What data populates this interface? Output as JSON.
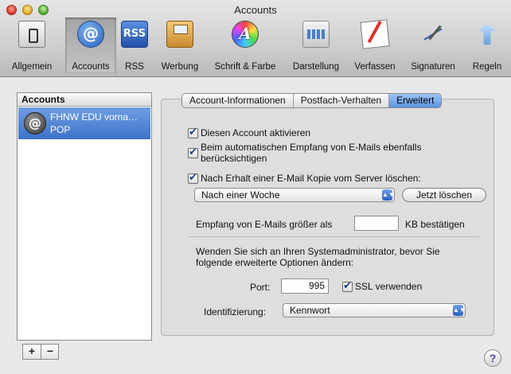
{
  "window": {
    "title": "Accounts"
  },
  "toolbar": {
    "items": [
      {
        "label": "Allgemein",
        "icon": "switch-icon"
      },
      {
        "label": "Accounts",
        "icon": "at-sign-icon",
        "selected": true
      },
      {
        "label": "RSS",
        "icon": "rss-icon",
        "icon_text": "RSS"
      },
      {
        "label": "Werbung",
        "icon": "junk-mail-icon"
      },
      {
        "label": "Schrift & Farbe",
        "icon": "font-color-icon",
        "icon_text": "A"
      },
      {
        "label": "Darstellung",
        "icon": "viewing-icon"
      },
      {
        "label": "Verfassen",
        "icon": "compose-icon"
      },
      {
        "label": "Signaturen",
        "icon": "signature-icon"
      },
      {
        "label": "Regeln",
        "icon": "rules-icon"
      }
    ]
  },
  "accounts": {
    "header": "Accounts",
    "items": [
      {
        "name": "FHNW EDU vorna…",
        "type": "POP",
        "selected": true
      }
    ],
    "add_label": "+",
    "remove_label": "−"
  },
  "tabs": [
    {
      "label": "Account-Informationen"
    },
    {
      "label": "Postfach-Verhalten"
    },
    {
      "label": "Erweitert",
      "active": true
    }
  ],
  "advanced": {
    "enable_account": {
      "label": "Diesen Account aktivieren",
      "checked": true
    },
    "include_auto": {
      "label_line1": "Beim automatischen Empfang von E-Mails ebenfalls",
      "label_line2": "berücksichtigen",
      "checked": true
    },
    "remove_copy": {
      "label": "Nach Erhalt einer E-Mail Kopie vom Server löschen:",
      "checked": true
    },
    "remove_when": "Nach einer Woche",
    "remove_now_label": "Jetzt löschen",
    "large_msg_prefix": "Empfang von E-Mails größer als",
    "large_msg_value": "",
    "large_msg_suffix": "KB bestätigen",
    "admin_note_line1": "Wenden Sie sich an Ihren Systemadministrator, bevor Sie",
    "admin_note_line2": "folgende erweiterte Optionen ändern:",
    "port_label": "Port:",
    "port_value": "995",
    "ssl": {
      "label": "SSL verwenden",
      "checked": true
    },
    "auth_label": "Identifizierung:",
    "auth_value": "Kennwort"
  },
  "help_label": "?"
}
